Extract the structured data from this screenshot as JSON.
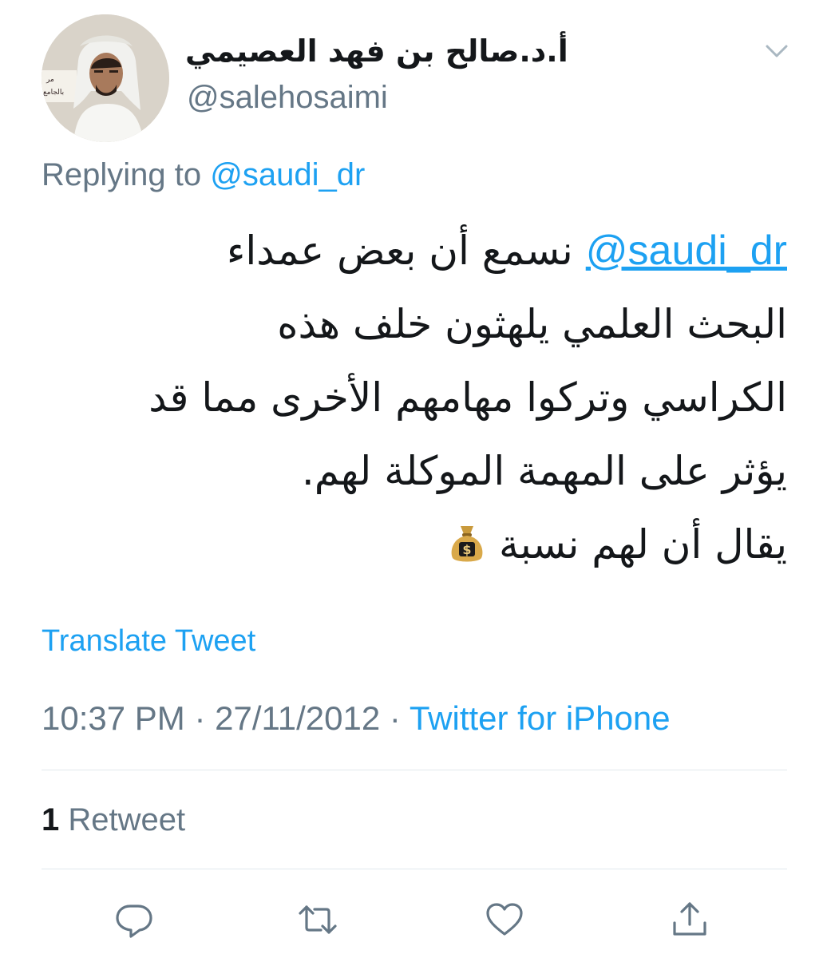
{
  "user": {
    "display_name": "أ.د.صالح بن فهد العصيمي",
    "handle": "@salehosaimi",
    "avatar_sign_text": [
      "مر",
      "بالجامع"
    ]
  },
  "reply": {
    "prefix": "Replying to",
    "to": "@saudi_dr"
  },
  "tweet": {
    "mention": "@saudi_dr",
    "line1": "نسمع أن بعض عمداء",
    "line2": "البحث العلمي يلهثون خلف هذه",
    "line3": "الكراسي وتركوا مهامهم الأخرى مما قد",
    "line4": "يؤثر على المهمة الموكلة لهم.",
    "line5": "يقال أن لهم نسبة",
    "emoji": "money-bag-icon"
  },
  "translate_label": "Translate Tweet",
  "meta": {
    "time": "10:37 PM",
    "separator": "·",
    "date": "27/11/2012",
    "source": "Twitter for iPhone"
  },
  "stats": {
    "retweet_count": "1",
    "retweet_label": "Retweet"
  },
  "actions": [
    "reply-icon",
    "retweet-icon",
    "like-icon",
    "share-icon"
  ],
  "colors": {
    "link": "#1da1f2",
    "secondary": "#657786",
    "primary_text": "#14171a",
    "divider": "#e1e8ed"
  }
}
